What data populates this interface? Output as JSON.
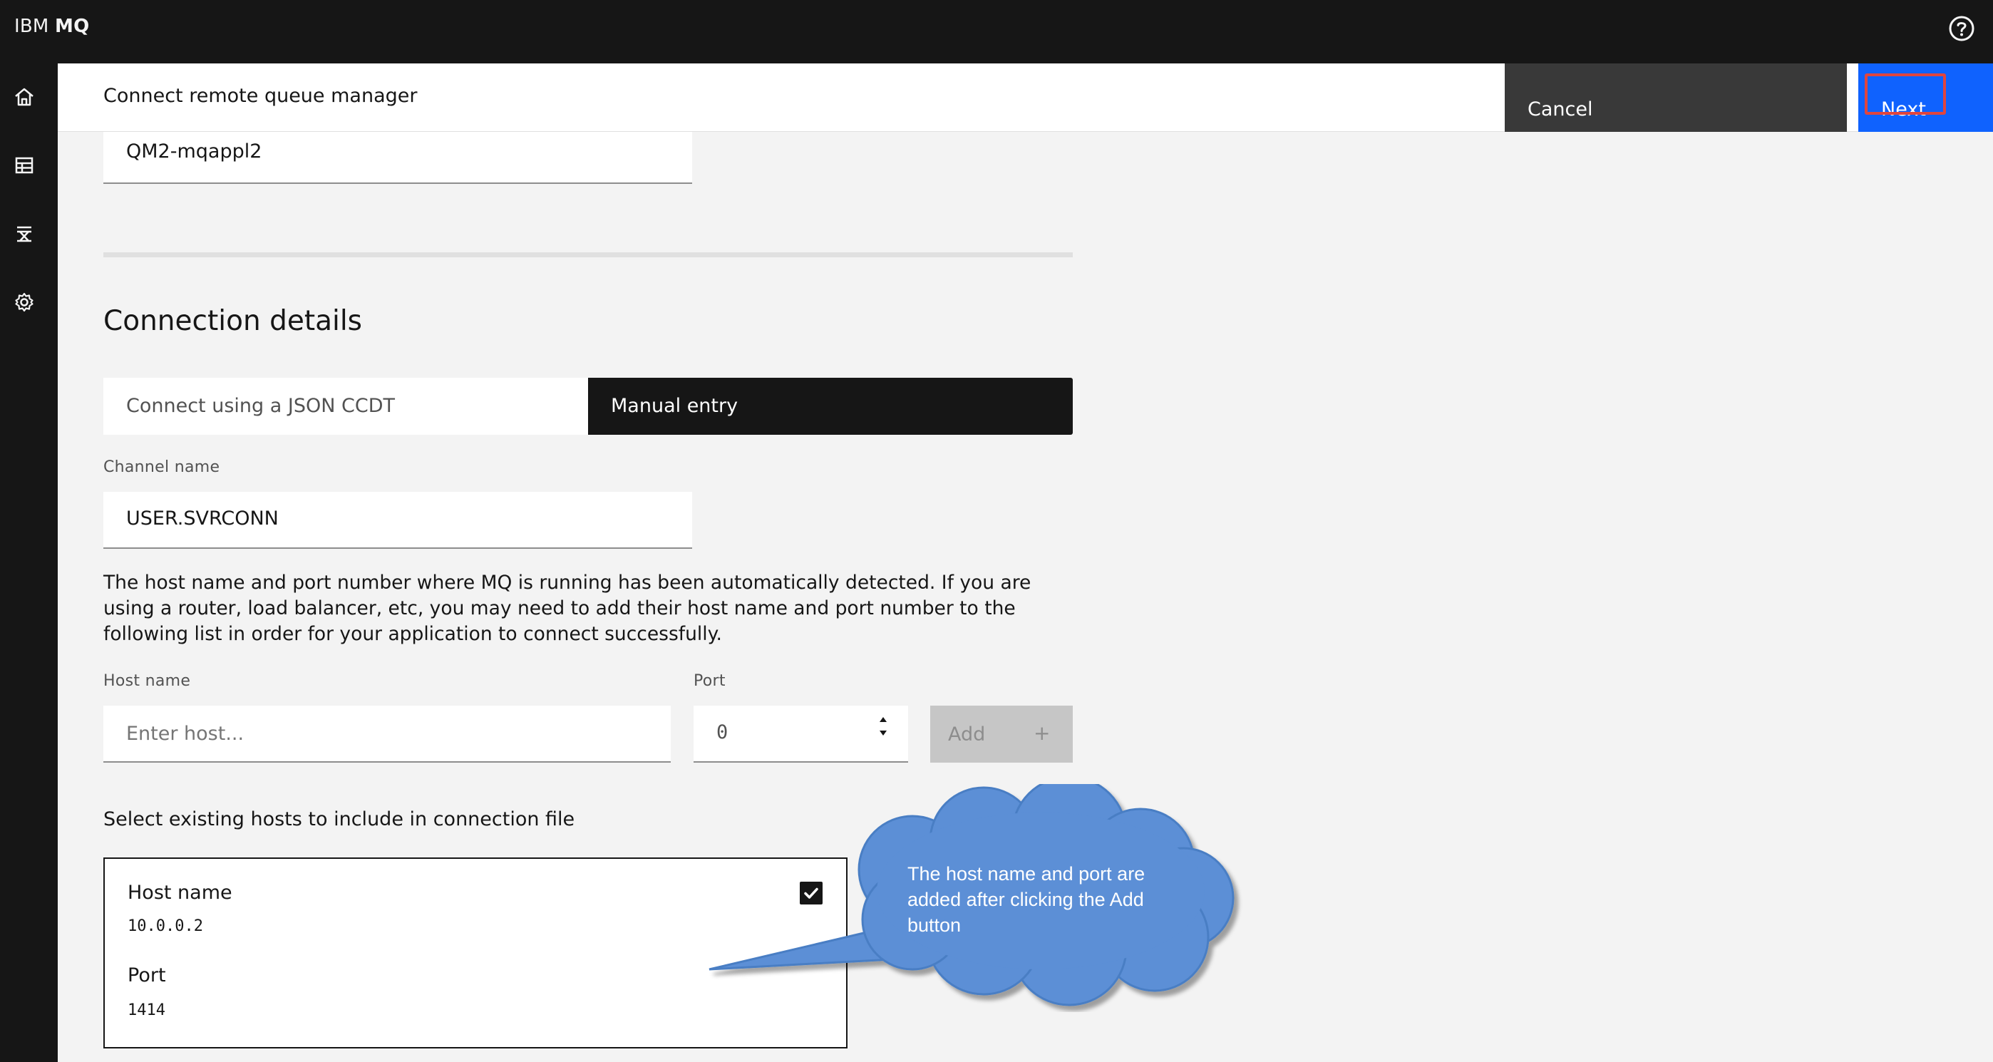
{
  "app": {
    "brand_prefix": "IBM",
    "brand_name": "MQ"
  },
  "topbar": {
    "help_icon": "help-icon"
  },
  "sidenav": {
    "items": [
      {
        "icon": "home-icon"
      },
      {
        "icon": "table-icon"
      },
      {
        "icon": "applications-icon"
      },
      {
        "icon": "gear-icon"
      }
    ]
  },
  "header": {
    "title": "Connect remote queue manager",
    "cancel_label": "Cancel",
    "next_label": "Next"
  },
  "form": {
    "qm_name_value": "QM2-mqappl2",
    "section_title": "Connection details",
    "switcher": {
      "option_json": "Connect using a JSON CCDT",
      "option_manual": "Manual entry",
      "selected": "Manual entry"
    },
    "channel_label": "Channel name",
    "channel_value": "USER.SVRCONN",
    "help_text": "The host name and port number where MQ is running has been automatically detected. If you are using a router, load balancer, etc, you may need to add their host name and port number to the following list in order for your application to connect successfully.",
    "host_label": "Host name",
    "host_placeholder": "Enter host...",
    "port_label": "Port",
    "port_value": "0",
    "add_label": "Add",
    "add_icon": "+"
  },
  "hosts": {
    "title": "Select existing hosts to include in connection file",
    "items": [
      {
        "host_label": "Host name",
        "host_value": "10.0.0.2",
        "port_label": "Port",
        "port_value": "1414",
        "checked": true
      }
    ]
  },
  "annotation": {
    "text": "The host name and port are added after clicking the Add button",
    "color": "#5b8fd6"
  },
  "colors": {
    "primary": "#0f62fe",
    "dark": "#161616",
    "cancel": "#393939",
    "highlight": "#e0453e"
  }
}
